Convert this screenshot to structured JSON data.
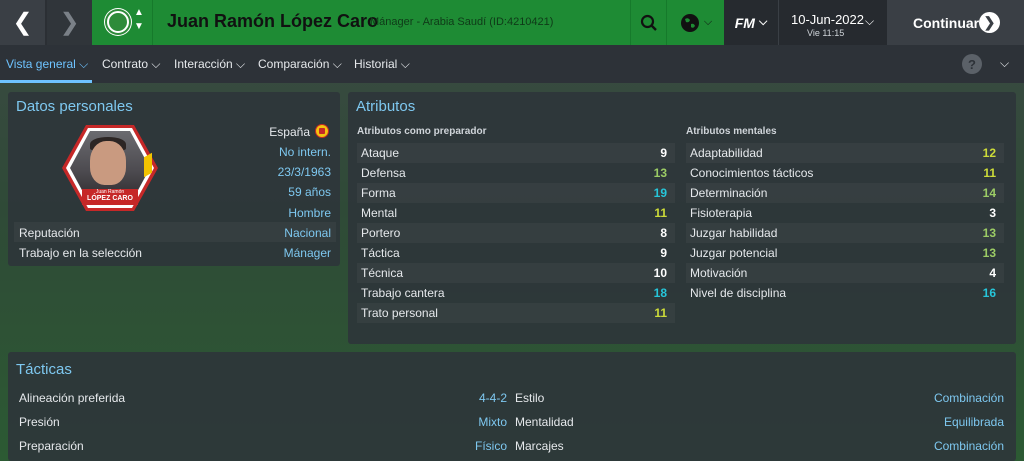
{
  "header": {
    "title": "Juan Ramón López Caro",
    "subtitle": "Mánager - Arabia Saudí (ID:4210421)",
    "fm_label": "FM",
    "date": "10-Jun-2022",
    "day": "Vie 11:15",
    "continue_label": "Continuar"
  },
  "tabs": [
    "Vista general",
    "Contrato",
    "Interacción",
    "Comparación",
    "Historial"
  ],
  "personal": {
    "title": "Datos personales",
    "portrait_name_small": "Juan Ramón",
    "portrait_name_big": "LÓPEZ CARO",
    "nationality": "España",
    "intl": "No intern.",
    "dob": "23/3/1963",
    "age": "59 años",
    "gender": "Hombre",
    "reputation_label": "Reputación",
    "reputation_value": "Nacional",
    "job_label": "Trabajo en la selección",
    "job_value": "Mánager"
  },
  "attributes": {
    "title": "Atributos",
    "coach_title": "Atributos como preparador",
    "mental_title": "Atributos mentales",
    "coach": [
      {
        "label": "Ataque",
        "value": "9",
        "color": "#ffffff"
      },
      {
        "label": "Defensa",
        "value": "13",
        "color": "#9ccc65"
      },
      {
        "label": "Forma",
        "value": "19",
        "color": "#26c6da"
      },
      {
        "label": "Mental",
        "value": "11",
        "color": "#cddc39"
      },
      {
        "label": "Portero",
        "value": "8",
        "color": "#ffffff"
      },
      {
        "label": "Táctica",
        "value": "9",
        "color": "#ffffff"
      },
      {
        "label": "Técnica",
        "value": "10",
        "color": "#ffffff"
      },
      {
        "label": "Trabajo cantera",
        "value": "18",
        "color": "#26c6da"
      },
      {
        "label": "Trato personal",
        "value": "11",
        "color": "#cddc39"
      }
    ],
    "mental": [
      {
        "label": "Adaptabilidad",
        "value": "12",
        "color": "#cddc39"
      },
      {
        "label": "Conocimientos tácticos",
        "value": "11",
        "color": "#cddc39"
      },
      {
        "label": "Determinación",
        "value": "14",
        "color": "#9ccc65"
      },
      {
        "label": "Fisioterapia",
        "value": "3",
        "color": "#ffffff"
      },
      {
        "label": "Juzgar habilidad",
        "value": "13",
        "color": "#9ccc65"
      },
      {
        "label": "Juzgar potencial",
        "value": "13",
        "color": "#9ccc65"
      },
      {
        "label": "Motivación",
        "value": "4",
        "color": "#ffffff"
      },
      {
        "label": "Nivel de disciplina",
        "value": "16",
        "color": "#26c6da"
      }
    ]
  },
  "tactics": {
    "title": "Tácticas",
    "left": [
      {
        "label": "Alineación preferida",
        "value": "4-4-2"
      },
      {
        "label": "Presión",
        "value": "Mixto"
      },
      {
        "label": "Preparación",
        "value": "Físico"
      }
    ],
    "right": [
      {
        "label": "Estilo",
        "value": "Combinación"
      },
      {
        "label": "Mentalidad",
        "value": "Equilibrada"
      },
      {
        "label": "Marcajes",
        "value": "Combinación"
      }
    ]
  }
}
